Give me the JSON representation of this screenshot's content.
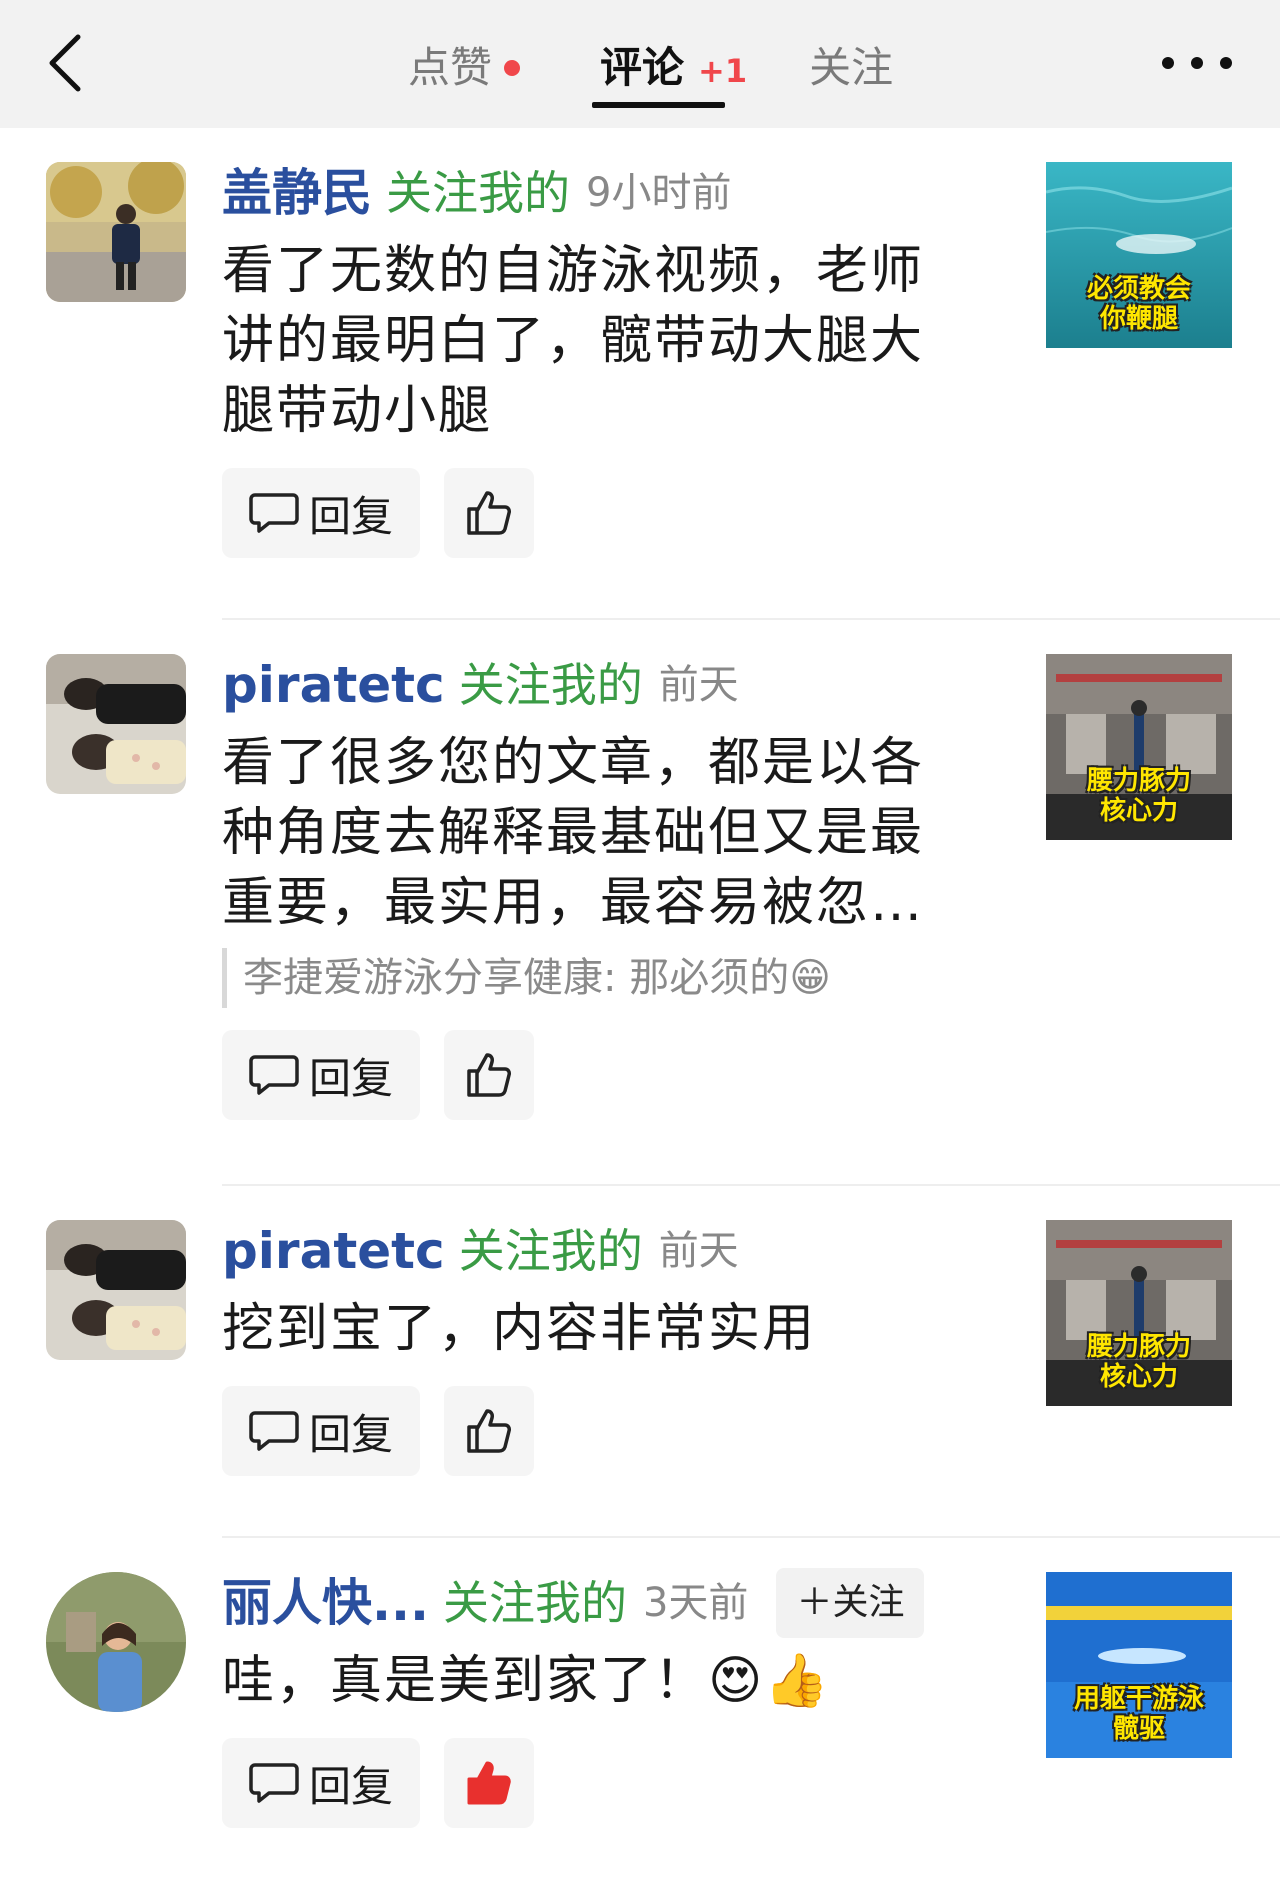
{
  "header": {
    "tabs": [
      {
        "label": "点赞"
      },
      {
        "label": "评论",
        "badge": "+1"
      },
      {
        "label": "关注"
      }
    ],
    "active_tab": "评论"
  },
  "comments": [
    {
      "author": "盖静民",
      "fan": "关注我的",
      "time": "9小时前",
      "text": "看了无数的自游泳视频，老师讲的最明白了，髋带动大腿大腿带动小腿",
      "reply_label": "回复",
      "liked": false,
      "thumb_caption_1": "必须教会",
      "thumb_caption_2": "你鞭腿"
    },
    {
      "author": "piratetc",
      "fan": "关注我的",
      "time": "前天",
      "text": "看了很多您的文章，都是以各种角度去解释最基础但又是最重要，最实用，最容易被忽…",
      "quote": "李捷爱游泳分享健康: 那必须的😁",
      "reply_label": "回复",
      "liked": false,
      "thumb_caption_1": "腰力豚力",
      "thumb_caption_2": "核心力"
    },
    {
      "author": "piratetc",
      "fan": "关注我的",
      "time": "前天",
      "text": "挖到宝了，内容非常实用",
      "reply_label": "回复",
      "liked": false,
      "thumb_caption_1": "腰力豚力",
      "thumb_caption_2": "核心力"
    },
    {
      "author": "丽人快...",
      "fan": "关注我的",
      "time": "3天前",
      "follow_label": "＋关注",
      "text": "哇，真是美到家了！😍👍",
      "reply_label": "回复",
      "liked": true,
      "thumb_caption_1": "用躯干游泳",
      "thumb_caption_2": "髋驱"
    }
  ],
  "colors": {
    "author": "#2a4f9e",
    "fan": "#3a9b45",
    "accent_red": "#f0474b"
  }
}
